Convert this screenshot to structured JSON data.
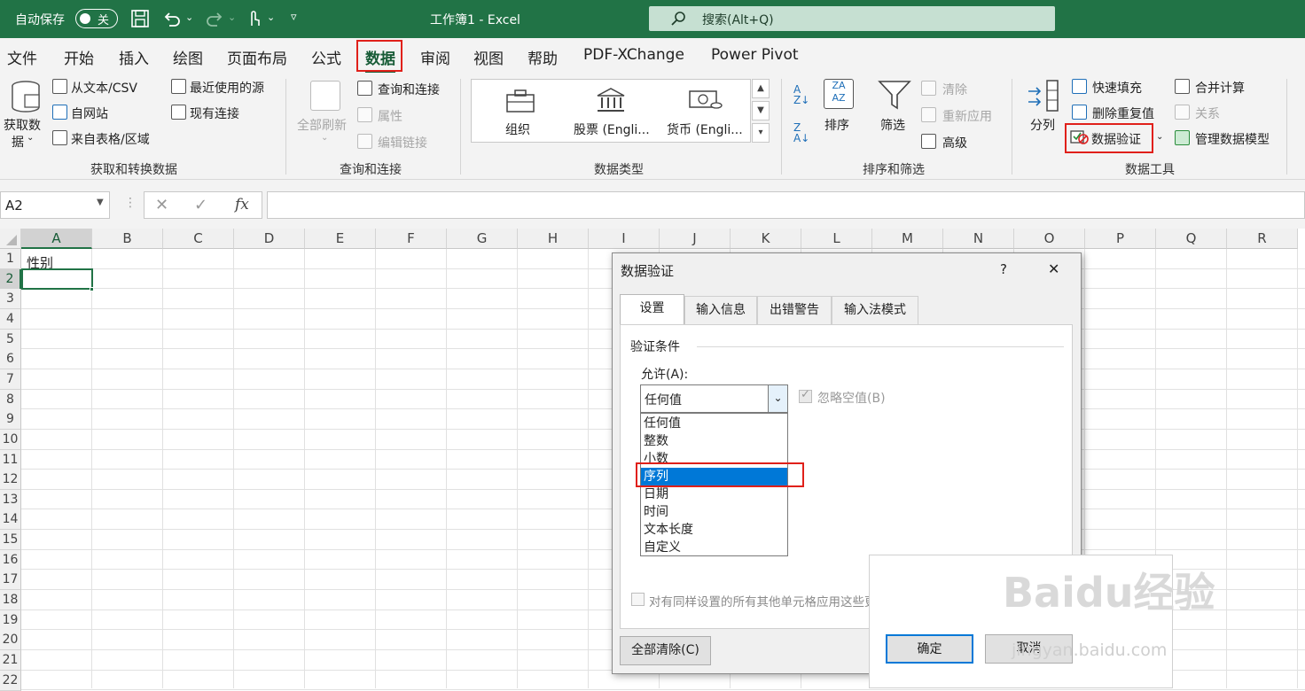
{
  "titlebar": {
    "autosave_label": "自动保存",
    "autosave_state": "关",
    "doc_title": "工作簿1  -  Excel",
    "search_placeholder": "搜索(Alt+Q)",
    "bg_color": "#217346"
  },
  "menu": {
    "tabs": [
      "文件",
      "开始",
      "插入",
      "绘图",
      "页面布局",
      "公式",
      "数据",
      "审阅",
      "视图",
      "帮助",
      "PDF-XChange",
      "Power Pivot"
    ],
    "active": "数据"
  },
  "ribbon": {
    "get_data": {
      "btn1": "获取数",
      "btn2": "据",
      "from_text": "从文本/CSV",
      "from_web": "自网站",
      "from_table": "来自表格/区域",
      "recent": "最近使用的源",
      "existing": "现有连接",
      "group": "获取和转换数据"
    },
    "queries": {
      "refresh_all": "全部刷新",
      "queries_conn": "查询和连接",
      "properties": "属性",
      "edit_links": "编辑链接",
      "group": "查询和连接"
    },
    "data_types": {
      "org": "组织",
      "stocks": "股票 (Engli...",
      "currency": "货币 (Engli...",
      "group": "数据类型"
    },
    "sort_filter": {
      "sort": "排序",
      "filter": "筛选",
      "clear": "清除",
      "reapply": "重新应用",
      "advanced": "高级",
      "group": "排序和筛选"
    },
    "data_tools": {
      "text_to_col": "分列",
      "flash_fill": "快速填充",
      "remove_dup": "删除重复值",
      "data_validation": "数据验证",
      "consolidate": "合并计算",
      "relationships": "关系",
      "data_model": "管理数据模型",
      "group": "数据工具"
    }
  },
  "formula_bar": {
    "name_box": "A2",
    "fx": "fx",
    "formula": ""
  },
  "sheet": {
    "columns": [
      "A",
      "B",
      "C",
      "D",
      "E",
      "F",
      "G",
      "H",
      "I",
      "J",
      "K",
      "L",
      "M",
      "N",
      "O",
      "P",
      "Q",
      "R"
    ],
    "rows": [
      "1",
      "2",
      "3",
      "4",
      "5",
      "6",
      "7",
      "8",
      "9",
      "10",
      "11",
      "12",
      "13",
      "14",
      "15",
      "16",
      "17",
      "18",
      "19",
      "20",
      "21",
      "22"
    ],
    "cells": {
      "A1": "性别"
    },
    "active_cell": "A2"
  },
  "dialog": {
    "title": "数据验证",
    "help": "?",
    "close": "✕",
    "tabs": [
      "设置",
      "输入信息",
      "出错警告",
      "输入法模式"
    ],
    "section": "验证条件",
    "allow_label": "允许(A):",
    "allow_value": "任何值",
    "ignore_blank": "忽略空值(B)",
    "options": [
      "任何值",
      "整数",
      "小数",
      "序列",
      "日期",
      "时间",
      "文本长度",
      "自定义"
    ],
    "selected_option": "序列",
    "apply_all": "对有同样设置的所有其他单元格应用这些更改(P)",
    "clear_all": "全部清除(C)",
    "ok": "确定",
    "cancel": "取消"
  },
  "watermark": {
    "brand": "Baidu经验",
    "url": "jingyan.baidu.com"
  }
}
